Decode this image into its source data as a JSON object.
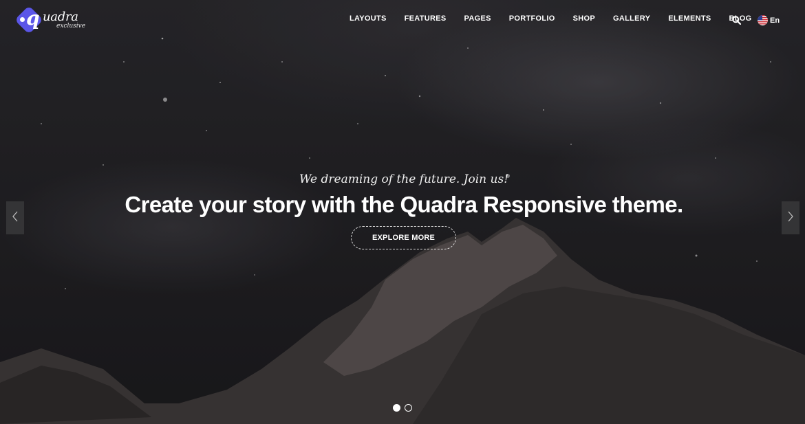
{
  "brand": {
    "logo_letter": "q",
    "name": "uadra",
    "sub": "exclusive",
    "accent": "#5b56e8"
  },
  "nav": {
    "items": [
      "LAYOUTS",
      "FEATURES",
      "PAGES",
      "PORTFOLIO",
      "SHOP",
      "GALLERY",
      "ELEMENTS",
      "BLOG"
    ],
    "search_icon": "search-icon",
    "language": "En"
  },
  "hero": {
    "tagline": "We dreaming of the future. Join us!",
    "headline": "Create your story with the Quadra Responsive theme.",
    "cta_label": "EXPLORE MORE",
    "prev_icon": "chevron-left-icon",
    "next_icon": "chevron-right-icon"
  },
  "slider": {
    "slide_count": 2,
    "active_slide": 1
  }
}
